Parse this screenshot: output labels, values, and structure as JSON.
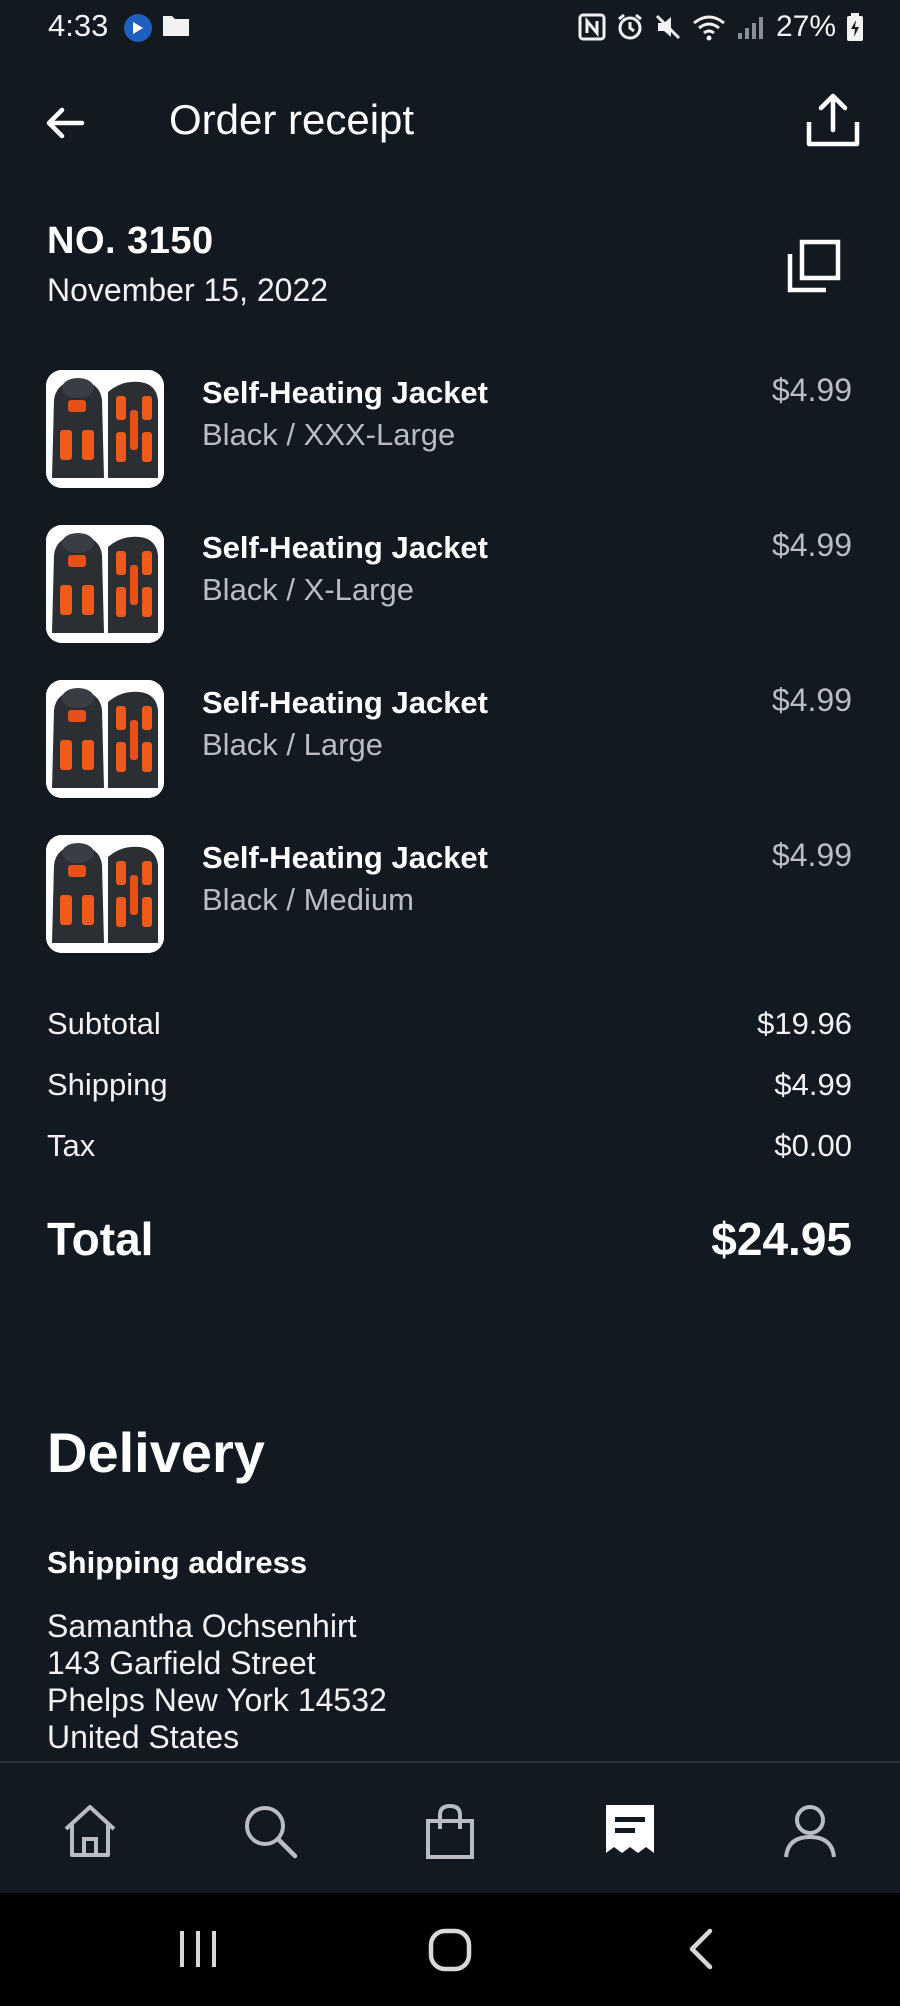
{
  "status_bar": {
    "time": "4:33",
    "battery": "27%",
    "icons": [
      "app-badge-icon",
      "folder-icon",
      "nfc-icon",
      "alarm-icon",
      "mute-icon",
      "wifi-icon",
      "signal-icon",
      "battery-charging-icon"
    ]
  },
  "app_bar": {
    "title": "Order receipt",
    "back_icon": "arrow-left-icon",
    "share_icon": "share-upload-icon"
  },
  "order": {
    "number": "NO. 3150",
    "date": "November 15, 2022",
    "copy_icon": "copy-icon"
  },
  "items": [
    {
      "name": "Self-Heating Jacket",
      "variant": "Black / XXX-Large",
      "price": "$4.99"
    },
    {
      "name": "Self-Heating Jacket",
      "variant": "Black / X-Large",
      "price": "$4.99"
    },
    {
      "name": "Self-Heating Jacket",
      "variant": "Black / Large",
      "price": "$4.99"
    },
    {
      "name": "Self-Heating Jacket",
      "variant": "Black / Medium",
      "price": "$4.99"
    }
  ],
  "summary": {
    "subtotal_label": "Subtotal",
    "subtotal": "$19.96",
    "shipping_label": "Shipping",
    "shipping": "$4.99",
    "tax_label": "Tax",
    "tax": "$0.00",
    "total_label": "Total",
    "total": "$24.95"
  },
  "delivery": {
    "title": "Delivery",
    "shipping_heading": "Shipping address",
    "address_lines": [
      "Samantha Ochsenhirt",
      "143 Garfield Street",
      "Phelps New York 14532",
      "United States"
    ]
  },
  "bottom_nav": {
    "items": [
      "home-icon",
      "search-icon",
      "shopping-bag-icon",
      "receipt-icon",
      "profile-icon"
    ],
    "active": "receipt-icon"
  },
  "colors": {
    "background": "#121920",
    "secondary_text": "#b9bcc0",
    "heater_orange": "#f05a1a"
  }
}
